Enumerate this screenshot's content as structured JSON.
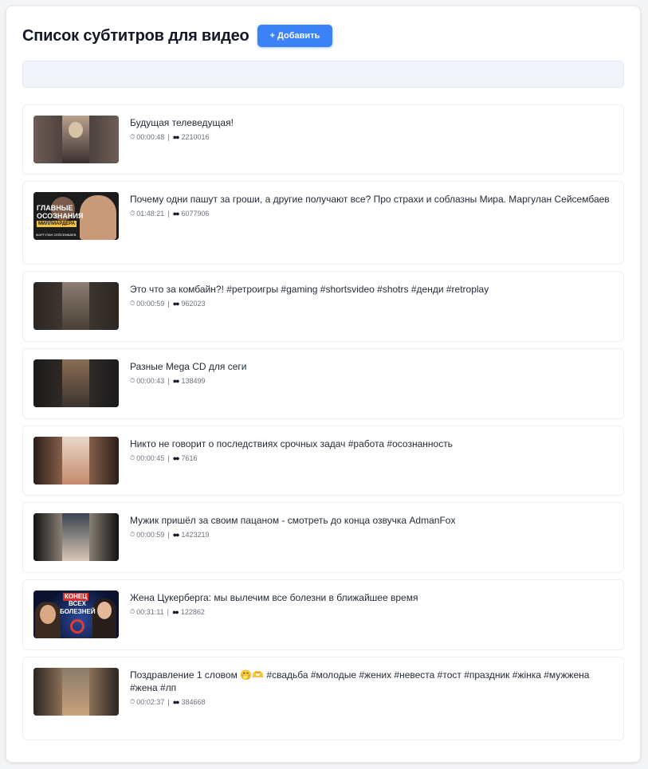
{
  "header": {
    "title": "Список субтитров для видео",
    "add_label": "+ Добавить"
  },
  "icons": {
    "duration": "stopwatch-icon",
    "views": "eyes-icon"
  },
  "colors": {
    "accent": "#3b82f6",
    "title_text": "#111827",
    "meta_text": "#6b7280"
  },
  "videos": [
    {
      "title": "Будущая телеведущая!",
      "duration": "00:00:48",
      "views": "2210016",
      "thumb": {
        "palette": [
          "#6d5d55",
          "#b9a08e",
          "#3a3030",
          "#d9c3a5"
        ]
      }
    },
    {
      "title": "Почему одни пашут за гроши, а другие получают все? Про страхи и соблазны Мира. Маргулан Сейсембаев",
      "duration": "01:48:21",
      "views": "6077906",
      "thumb": {
        "palette": [
          "#1b1b1b",
          "#c89a7a",
          "#f5c542"
        ],
        "text_lines": [
          "ГЛАВНЫЕ",
          "ОСОЗНАНИЯ",
          "МИЛЛИАРДЕРА"
        ],
        "caption": "МАРГУЛАН СЕЙСЕМБАЕВ"
      }
    },
    {
      "title": "Это что за комбайн?! #ретроигры #gaming #shortsvideo #shotrs #денди #retroplay",
      "duration": "00:00:59",
      "views": "962023",
      "thumb": {
        "palette": [
          "#2b2622",
          "#8b7d70",
          "#4a4038"
        ]
      }
    },
    {
      "title": "Разные Mega CD для сеги",
      "duration": "00:00:43",
      "views": "138499",
      "thumb": {
        "palette": [
          "#1a1a1a",
          "#8a6d55",
          "#3c342e"
        ]
      }
    },
    {
      "title": "Никто не говорит о последствиях срочных задач #работа #осознанность",
      "duration": "00:00:45",
      "views": "7616",
      "thumb": {
        "palette": [
          "#2a1e18",
          "#e8d8c8",
          "#c48a6a"
        ]
      }
    },
    {
      "title": "Мужик пришёл за своим пацаном - смотреть до конца озвучка AdmanFox",
      "duration": "00:00:59",
      "views": "1423219",
      "thumb": {
        "palette": [
          "#121212",
          "#3a4450",
          "#d9c7b5"
        ]
      }
    },
    {
      "title": "Жена Цукерберга: мы вылечим все болезни в ближайшее время",
      "duration": "00:31:11",
      "views": "122862",
      "thumb": {
        "palette": [
          "#0a1230",
          "#d32f2f",
          "#e0b090"
        ],
        "text_lines": [
          "КОНЕЦ",
          "ВСЕХ",
          "БОЛЕЗНЕЙ"
        ]
      }
    },
    {
      "title": "Поздравление 1 словом 🤭🫶 #свадьба #молодые #жених #невеста #тост #праздник #жінка #мужжена #жена #лп",
      "duration": "00:02:37",
      "views": "384668",
      "thumb": {
        "palette": [
          "#2c2520",
          "#8a7a6a",
          "#c9a27a"
        ]
      }
    }
  ]
}
